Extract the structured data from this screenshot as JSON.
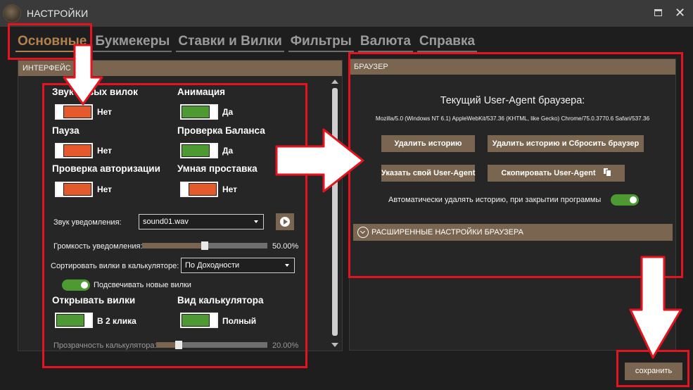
{
  "window": {
    "title": "НАСТРОЙКИ"
  },
  "tabs": [
    {
      "label": "Основные",
      "active": true
    },
    {
      "label": "Букмекеры",
      "active": false
    },
    {
      "label": "Ставки и Вилки",
      "active": false
    },
    {
      "label": "Фильтры",
      "active": false
    },
    {
      "label": "Валюта",
      "active": false
    },
    {
      "label": "Справка",
      "active": false
    }
  ],
  "interface": {
    "header": "ИНТЕРФЕЙС",
    "toggles": [
      {
        "label": "Звук новых вилок",
        "state": "Нет",
        "on": false
      },
      {
        "label": "Анимация",
        "state": "Да",
        "on": true
      },
      {
        "label": "Пауза",
        "state": "Нет",
        "on": false
      },
      {
        "label": "Проверка Баланса",
        "state": "Да",
        "on": true
      },
      {
        "label": "Проверка авторизации",
        "state": "Нет",
        "on": false
      },
      {
        "label": "Умная проставка",
        "state": "Нет",
        "on": false
      }
    ],
    "sound": {
      "label": "Звук уведомления:",
      "value": "sound01.wav"
    },
    "volume": {
      "label": "Громкость уведомления:",
      "value_text": "50.00%",
      "fraction": 0.5
    },
    "sort": {
      "label": "Сортировать вилки в калькуляторе:",
      "value": "По Доходности"
    },
    "highlight": {
      "label": "Подсвечивать новые вилки",
      "on": true
    },
    "open_forks": {
      "label": "Открывать вилки",
      "state": "В 2 клика",
      "on": true
    },
    "calc_view": {
      "label": "Вид калькулятора",
      "state": "Полный",
      "on": true
    },
    "transparency": {
      "label": "Прозрачность калькулятора:",
      "value_text": "20.00%",
      "fraction": 0.2
    }
  },
  "browser": {
    "header": "БРАУЗЕР",
    "ua_title": "Текущий User-Agent браузера:",
    "ua_string": "Mozilla/5.0 (Windows NT 6.1) AppleWebKit/537.36 (KHTML, like Gecko) Chrome/75.0.3770.6 Safari/537.36",
    "btn_clear_history": "Удалить историю",
    "btn_clear_reset": "Удалить историю и Сбросить браузер",
    "btn_set_ua": "Указать свой User-Agent",
    "btn_copy_ua": "Скопировать User-Agent",
    "auto_clear": {
      "label": "Автоматически удалять историю, при закрытии программы",
      "on": true
    },
    "advanced_label": "РАСШИРЕННЫЕ НАСТРОЙКИ БРАУЗЕРА"
  },
  "save_label": "сохранить",
  "colors": {
    "accent": "#7a6650",
    "on": "#4e9a32",
    "off": "#e55a2d",
    "annotation": "#e3141f"
  }
}
